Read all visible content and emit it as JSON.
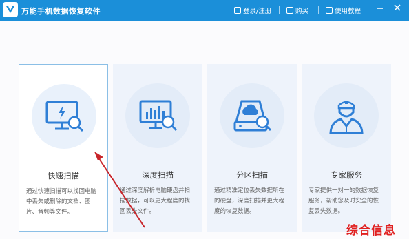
{
  "window": {
    "title": "万能手机数据恢复软件"
  },
  "toolbar": {
    "login": "登录/注册",
    "purchase": "购买",
    "tutorial": "使用教程"
  },
  "cards": [
    {
      "title": "快速扫描",
      "desc": "通过快速扫描可以找回电脑中丢失或删除的文档、图片、音频等文件。",
      "icon": "monitor-lightning-search-icon",
      "selected": true
    },
    {
      "title": "深度扫描",
      "desc": "通过深度解析电脑硬盘并扫描数据，可以更大程度的找回丢失文件。",
      "icon": "monitor-chart-search-icon",
      "selected": false
    },
    {
      "title": "分区扫描",
      "desc": "通过精准定位丢失数据所在的硬盘，深度扫描并更大程度的恢复数据。",
      "icon": "drive-cloud-search-icon",
      "selected": false
    },
    {
      "title": "专家服务",
      "desc": "专家提供一对一的数据恢复服务，帮助您及时安全的恢复丢失数据。",
      "icon": "expert-person-icon",
      "selected": false
    }
  ],
  "watermark": "综合信息",
  "colors": {
    "titlebar": "#1b8fd9",
    "card_bg": "#eef3fb",
    "selected_border": "#8bbfe6",
    "icon_blue": "#2f7fd6",
    "arrow": "#c8252a",
    "watermark": "#e02020"
  }
}
